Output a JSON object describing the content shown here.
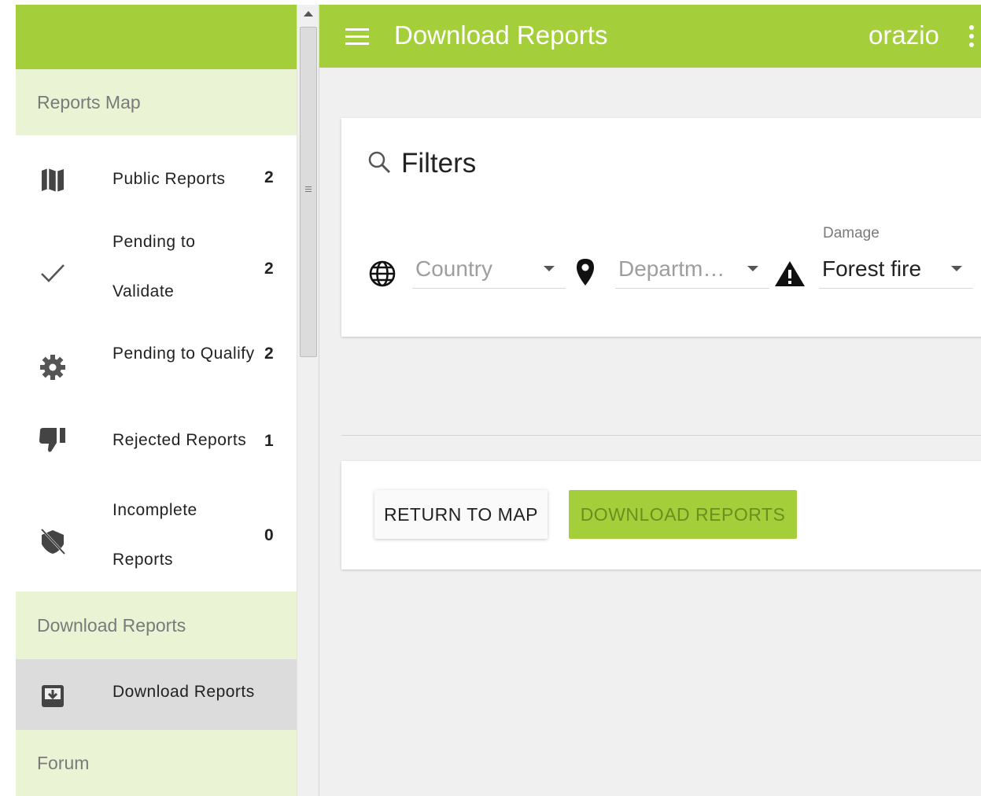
{
  "sidebar": {
    "sections": {
      "reports_map": "Reports Map",
      "download_reports": "Download Reports",
      "forum": "Forum"
    },
    "items": {
      "public": {
        "label": "Public Reports",
        "count": "2",
        "icon": "map-icon"
      },
      "pending_validate": {
        "label_line1": "Pending to",
        "label_line2": "Validate",
        "count": "2",
        "icon": "check-icon"
      },
      "pending_qualify": {
        "label": "Pending to Qualify",
        "count": "2",
        "icon": "gear-icon"
      },
      "rejected": {
        "label": "Rejected Reports",
        "count": "1",
        "icon": "thumb-down-icon"
      },
      "incomplete": {
        "label_line1": "Incomplete",
        "label_line2": "Reports",
        "count": "0",
        "icon": "eye-off-icon"
      },
      "download": {
        "label": "Download Reports",
        "icon": "download-box-icon"
      }
    }
  },
  "header": {
    "title": "Download Reports",
    "user": "orazio"
  },
  "filters": {
    "title": "Filters",
    "country_placeholder": "Country",
    "department_placeholder": "Departm…",
    "damage_label": "Damage",
    "damage_value": "Forest fire"
  },
  "actions": {
    "return_label": "RETURN TO MAP",
    "download_label": "DOWNLOAD REPORTS"
  },
  "colors": {
    "brand_green": "#a5cf3a",
    "section_bg": "#eaf4d5",
    "active_item_bg": "#dcdcdc"
  }
}
